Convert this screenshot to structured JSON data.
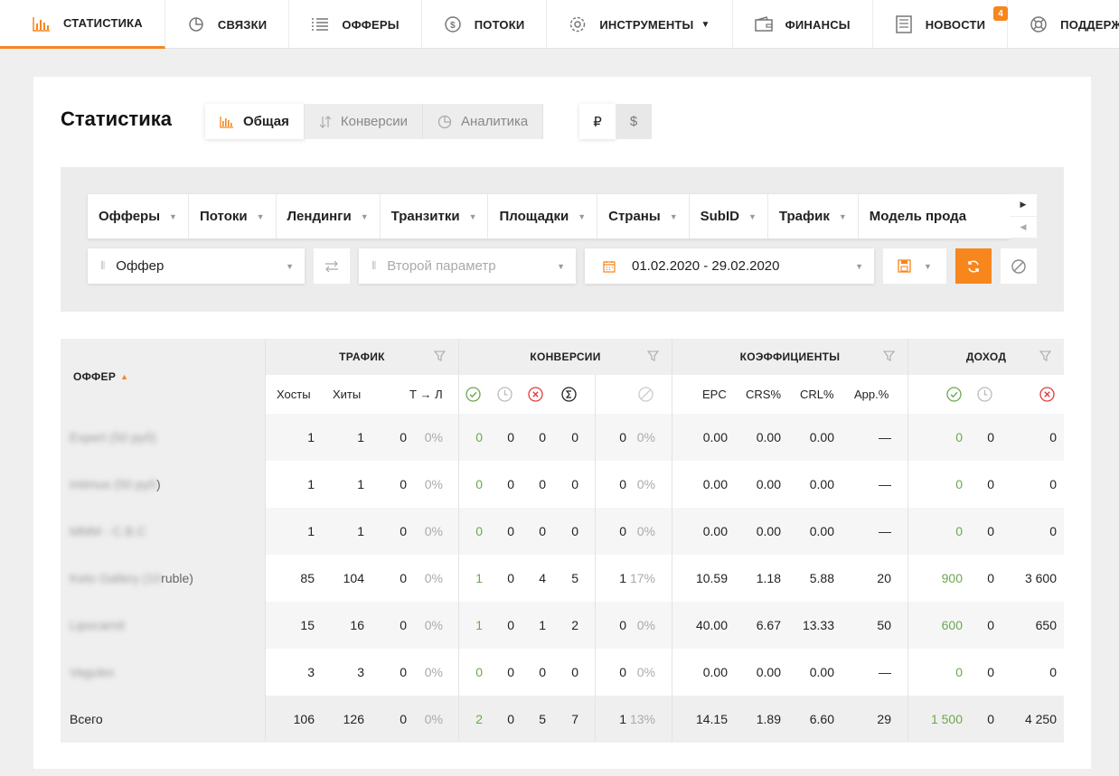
{
  "nav": {
    "items": [
      {
        "label": "СТАТИСТИКА",
        "icon": "bar-chart-icon",
        "active": true
      },
      {
        "label": "СВЯЗКИ",
        "icon": "pie-chart-icon"
      },
      {
        "label": "ОФФЕРЫ",
        "icon": "list-icon"
      },
      {
        "label": "ПОТОКИ",
        "icon": "dollar-circle-icon"
      },
      {
        "label": "ИНСТРУМЕНТЫ",
        "icon": "gear-icon",
        "dropdown": true
      },
      {
        "label": "ФИНАНСЫ",
        "icon": "wallet-icon"
      },
      {
        "label": "НОВОСТИ",
        "icon": "newspaper-icon"
      },
      {
        "label": "ПОДДЕРЖКА",
        "icon": "lifebuoy-icon"
      }
    ],
    "support_badge": "4"
  },
  "page": {
    "title": "Статистика",
    "tabs": [
      "Общая",
      "Конверсии",
      "Аналитика"
    ],
    "currencies": [
      "₽",
      "$"
    ]
  },
  "filters": {
    "tabs": [
      "Офферы",
      "Потоки",
      "Лендинги",
      "Транзитки",
      "Площадки",
      "Страны",
      "SubID",
      "Трафик",
      "Модель прода"
    ],
    "first_param": "Оффер",
    "second_param_placeholder": "Второй параметр",
    "date_range": "01.02.2020 - 29.02.2020"
  },
  "table": {
    "offer_header": "ОФФЕР",
    "groups": [
      "ТРАФИК",
      "КОНВЕРСИИ",
      "КОЭФФИЦИЕНТЫ",
      "ДОХОД"
    ],
    "traffic_cols": [
      "Хосты",
      "Хиты",
      "Т → Л"
    ],
    "coef_cols": [
      "EPC",
      "CRS%",
      "CRL%",
      "App.%"
    ],
    "rows": [
      {
        "label": "Expert (50 руб)",
        "suffix": "",
        "hosts": "1",
        "hits": "1",
        "tl": "0",
        "tl_pct": "0%",
        "c_ok": "0",
        "c_wait": "0",
        "c_rej": "0",
        "c_sum": "0",
        "c_x": "0",
        "c_x_pct": "0%",
        "epc": "0.00",
        "crs": "0.00",
        "crl": "0.00",
        "app": "—",
        "i_ok": "0",
        "i_wait": "0",
        "i_rej": "0"
      },
      {
        "label": "Intimus (50 руб",
        "suffix": ")",
        "hosts": "1",
        "hits": "1",
        "tl": "0",
        "tl_pct": "0%",
        "c_ok": "0",
        "c_wait": "0",
        "c_rej": "0",
        "c_sum": "0",
        "c_x": "0",
        "c_x_pct": "0%",
        "epc": "0.00",
        "crs": "0.00",
        "crl": "0.00",
        "app": "—",
        "i_ok": "0",
        "i_wait": "0",
        "i_rej": "0"
      },
      {
        "label": "MMM - C.B.C",
        "suffix": "",
        "hosts": "1",
        "hits": "1",
        "tl": "0",
        "tl_pct": "0%",
        "c_ok": "0",
        "c_wait": "0",
        "c_rej": "0",
        "c_sum": "0",
        "c_x": "0",
        "c_x_pct": "0%",
        "epc": "0.00",
        "crs": "0.00",
        "crl": "0.00",
        "app": "—",
        "i_ok": "0",
        "i_wait": "0",
        "i_rej": "0"
      },
      {
        "label": "Keto Gallery (10",
        "suffix": " ruble)",
        "hosts": "85",
        "hits": "104",
        "tl": "0",
        "tl_pct": "0%",
        "c_ok": "1",
        "c_wait": "0",
        "c_rej": "4",
        "c_sum": "5",
        "c_x": "1",
        "c_x_pct": "17%",
        "epc": "10.59",
        "crs": "1.18",
        "crl": "5.88",
        "app": "20",
        "i_ok": "900",
        "i_wait": "0",
        "i_rej": "3 600"
      },
      {
        "label": "Lipocarnit",
        "suffix": "",
        "hosts": "15",
        "hits": "16",
        "tl": "0",
        "tl_pct": "0%",
        "c_ok": "1",
        "c_wait": "0",
        "c_rej": "1",
        "c_sum": "2",
        "c_x": "0",
        "c_x_pct": "0%",
        "epc": "40.00",
        "crs": "6.67",
        "crl": "13.33",
        "app": "50",
        "i_ok": "600",
        "i_wait": "0",
        "i_rej": "650"
      },
      {
        "label": "Vagulex",
        "suffix": "",
        "hosts": "3",
        "hits": "3",
        "tl": "0",
        "tl_pct": "0%",
        "c_ok": "0",
        "c_wait": "0",
        "c_rej": "0",
        "c_sum": "0",
        "c_x": "0",
        "c_x_pct": "0%",
        "epc": "0.00",
        "crs": "0.00",
        "crl": "0.00",
        "app": "—",
        "i_ok": "0",
        "i_wait": "0",
        "i_rej": "0"
      }
    ],
    "total": {
      "label": "Всего",
      "suffix": "",
      "hosts": "106",
      "hits": "126",
      "tl": "0",
      "tl_pct": "0%",
      "c_ok": "2",
      "c_wait": "0",
      "c_rej": "5",
      "c_sum": "7",
      "c_x": "1",
      "c_x_pct": "13%",
      "epc": "14.15",
      "crs": "1.89",
      "crl": "6.60",
      "app": "29",
      "i_ok": "1 500",
      "i_wait": "0",
      "i_rej": "4 250"
    }
  },
  "colors": {
    "accent": "#f7861c",
    "green": "#6aa84f",
    "red": "#e03b3b"
  }
}
